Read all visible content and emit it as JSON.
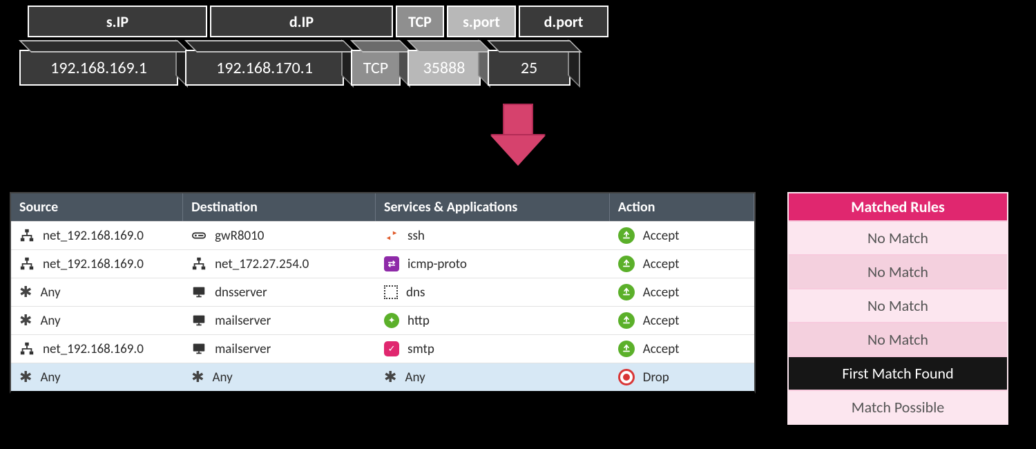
{
  "packet": {
    "headers": {
      "sip": "s.IP",
      "dip": "d.IP",
      "proto": "TCP",
      "sport": "s.port",
      "dport": "d.port"
    },
    "values": {
      "sip": "192.168.169.1",
      "dip": "192.168.170.1",
      "proto": "TCP",
      "sport": "35888",
      "dport": "25"
    }
  },
  "rules_table": {
    "columns": {
      "src": "Source",
      "dst": "Destination",
      "svc": "Services & Applications",
      "act": "Action"
    },
    "rows": [
      {
        "src": "net_192.168.169.0",
        "src_kind": "net",
        "dst": "gwR8010",
        "dst_kind": "gateway",
        "svc": "ssh",
        "svc_kind": "ssh",
        "action": "Accept"
      },
      {
        "src": "net_192.168.169.0",
        "src_kind": "net",
        "dst": "net_172.27.254.0",
        "dst_kind": "net",
        "svc": "icmp-proto",
        "svc_kind": "icmp",
        "action": "Accept"
      },
      {
        "src": "Any",
        "src_kind": "any",
        "dst": "dnsserver",
        "dst_kind": "host",
        "svc": "dns",
        "svc_kind": "dns",
        "action": "Accept"
      },
      {
        "src": "Any",
        "src_kind": "any",
        "dst": "mailserver",
        "dst_kind": "host",
        "svc": "http",
        "svc_kind": "http",
        "action": "Accept"
      },
      {
        "src": "net_192.168.169.0",
        "src_kind": "net",
        "dst": "mailserver",
        "dst_kind": "host",
        "svc": "smtp",
        "svc_kind": "smtp",
        "action": "Accept"
      },
      {
        "src": "Any",
        "src_kind": "any",
        "dst": "Any",
        "dst_kind": "any",
        "svc": "Any",
        "svc_kind": "any",
        "action": "Drop",
        "selected": true
      }
    ]
  },
  "matched": {
    "title": "Matched Rules",
    "rows": [
      {
        "text": "No Match",
        "style": "plain"
      },
      {
        "text": "No Match",
        "style": "alt"
      },
      {
        "text": "No Match",
        "style": "plain"
      },
      {
        "text": "No Match",
        "style": "alt"
      },
      {
        "text": "First Match Found",
        "style": "hit"
      },
      {
        "text": "Match Possible",
        "style": "plain"
      }
    ]
  }
}
